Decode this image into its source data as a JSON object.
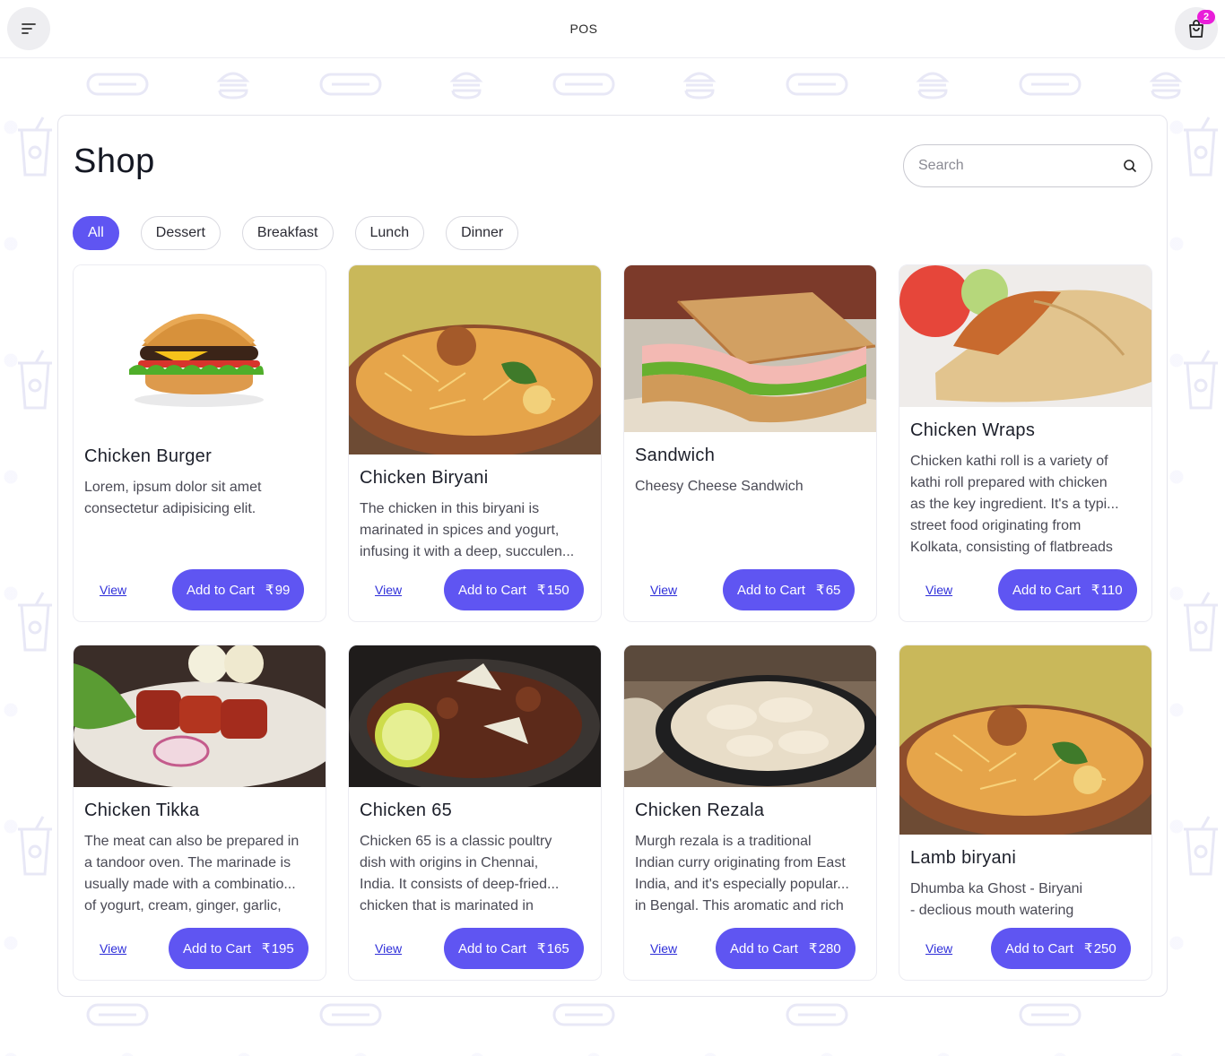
{
  "header": {
    "title": "POS",
    "cart_count": "2"
  },
  "shop": {
    "title": "Shop",
    "search_placeholder": "Search",
    "categories": [
      "All",
      "Dessert",
      "Breakfast",
      "Lunch",
      "Dinner"
    ],
    "active_category": "All",
    "add_label": "Add to Cart",
    "view_label": "View",
    "currency": "₹",
    "items": [
      {
        "name": "Chicken Burger",
        "desc": [
          "Lorem, ipsum dolor sit amet",
          "consectetur adipisicing elit."
        ],
        "price": "99"
      },
      {
        "name": "Chicken Biryani",
        "desc": [
          "The chicken in this biryani is",
          "marinated in spices and yogurt,",
          "infusing it with a deep, succulen..."
        ],
        "price": "150"
      },
      {
        "name": "Sandwich",
        "desc": [
          "Cheesy Cheese Sandwich"
        ],
        "price": "65"
      },
      {
        "name": "Chicken Wraps",
        "desc": [
          "Chicken kathi roll is a variety of",
          "kathi roll prepared with chicken",
          "as the key ingredient. It's a typi...",
          "street food originating from",
          "Kolkata, consisting of flatbreads"
        ],
        "price": "110"
      },
      {
        "name": "Chicken Tikka",
        "desc": [
          "The meat can also be prepared in",
          "a tandoor oven. The marinade is",
          "usually made with a combinatio...",
          "of yogurt, cream, ginger, garlic,"
        ],
        "price": "195"
      },
      {
        "name": "Chicken 65",
        "desc": [
          "Chicken 65 is a classic poultry",
          "dish with origins in Chennai,",
          "India. It consists of deep-fried...",
          "chicken that is marinated in"
        ],
        "price": "165"
      },
      {
        "name": "Chicken Rezala",
        "desc": [
          "Murgh rezala is a traditional",
          "Indian curry originating from East",
          "India, and it's especially popular...",
          "in Bengal. This aromatic and rich"
        ],
        "price": "280"
      },
      {
        "name": "Lamb biryani",
        "desc": [
          "Dhumba ka Ghost - Biryani",
          "- declious mouth watering"
        ],
        "price": "250"
      }
    ]
  }
}
